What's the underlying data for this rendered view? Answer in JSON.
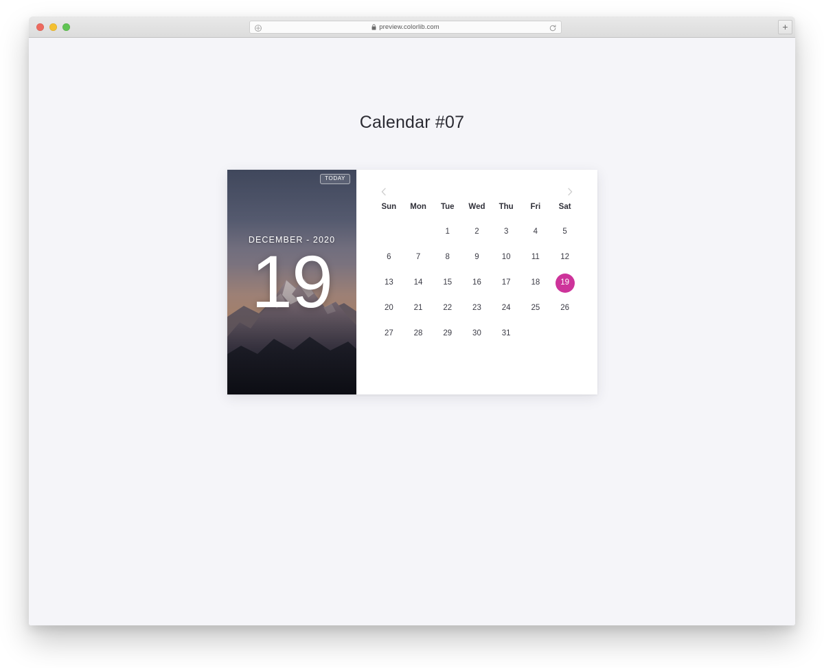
{
  "browser": {
    "url": "preview.colorlib.com",
    "lock_icon": "lock-icon",
    "left_icon": "compass-icon",
    "reload_icon": "reload-icon",
    "new_tab_label": "+",
    "traffic_lights": [
      "close",
      "minimize",
      "maximize"
    ]
  },
  "page": {
    "title": "Calendar #07",
    "background_color": "#f5f5f9"
  },
  "calendar": {
    "accent_color": "#cd339a",
    "photo": {
      "today_badge": "TODAY",
      "month_year": "DECEMBER - 2020",
      "day_number": "19"
    },
    "nav": {
      "prev_icon": "chevron-left-icon",
      "next_icon": "chevron-right-icon"
    },
    "weekdays": [
      "Sun",
      "Mon",
      "Tue",
      "Wed",
      "Thu",
      "Fri",
      "Sat"
    ],
    "selected_day": 19,
    "weeks": [
      [
        "",
        "",
        "1",
        "2",
        "3",
        "4",
        "5"
      ],
      [
        "6",
        "7",
        "8",
        "9",
        "10",
        "11",
        "12"
      ],
      [
        "13",
        "14",
        "15",
        "16",
        "17",
        "18",
        "19"
      ],
      [
        "20",
        "21",
        "22",
        "23",
        "24",
        "25",
        "26"
      ],
      [
        "27",
        "28",
        "29",
        "30",
        "31",
        "",
        ""
      ]
    ]
  }
}
